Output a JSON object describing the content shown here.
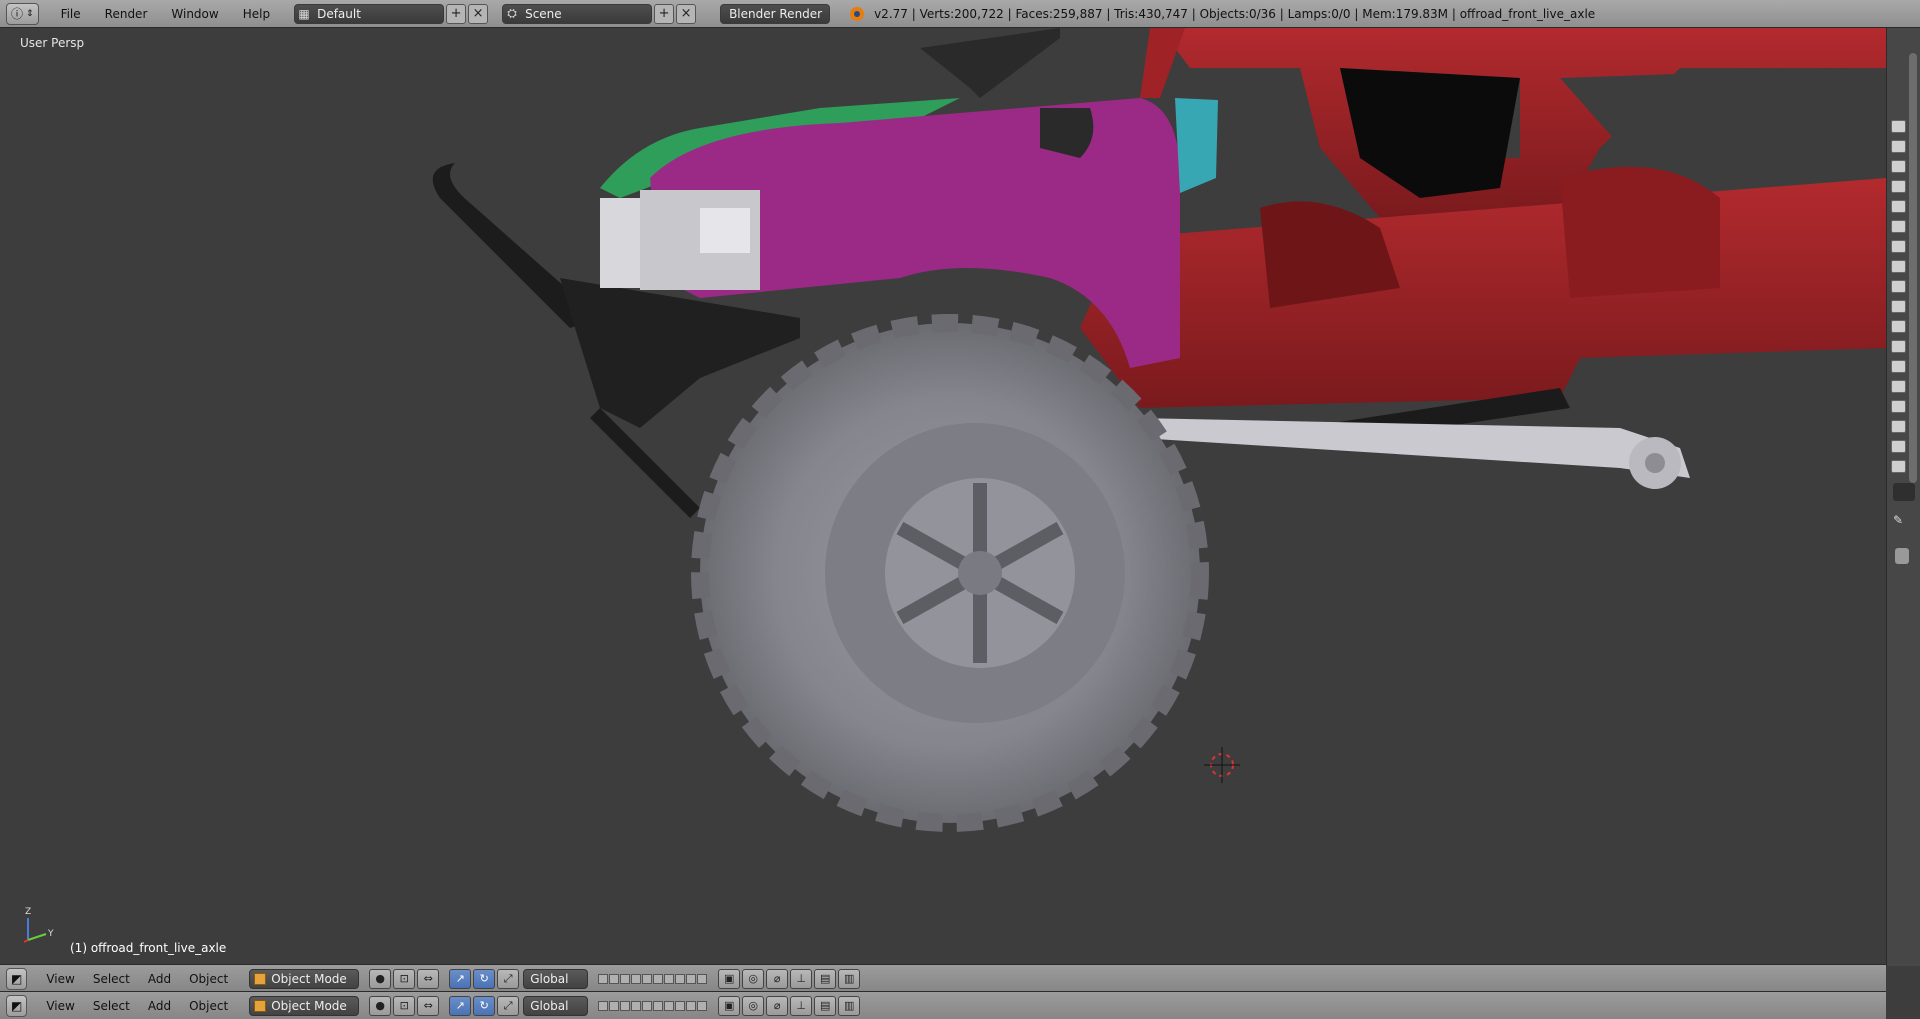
{
  "top": {
    "menus": [
      "File",
      "Render",
      "Window",
      "Help"
    ],
    "layout_name": "Default",
    "scene_name": "Scene",
    "render_engine": "Blender Render",
    "stats": "v2.77 | Verts:200,722 | Faces:259,887 | Tris:430,747 | Objects:0/36 | Lamps:0/0 | Mem:179.83M | offroad_front_live_axle"
  },
  "viewport": {
    "view_label": "User Persp",
    "object_label": "(1) offroad_front_live_axle",
    "axis_labels": {
      "z": "Z",
      "y": "Y"
    },
    "colors": {
      "body": "#a02226",
      "fender": "#9b2a86",
      "hood": "#2e9e5a",
      "accent": "#37a7b4",
      "tire": "#8a8a92",
      "cage": "#1c1c1c"
    }
  },
  "headers": [
    {
      "menus": [
        "View",
        "Select",
        "Add",
        "Object"
      ],
      "mode": "Object Mode",
      "orientation": "Global"
    },
    {
      "menus": [
        "View",
        "Select",
        "Add",
        "Object"
      ],
      "mode": "Object Mode",
      "orientation": "Global"
    }
  ]
}
